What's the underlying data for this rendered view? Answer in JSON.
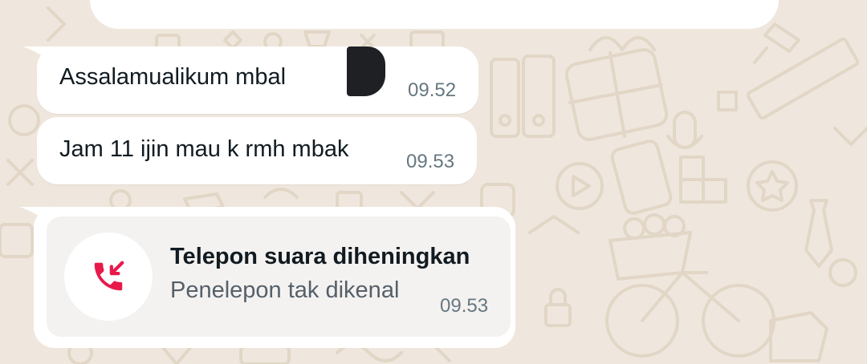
{
  "messages": [
    {
      "text": "Assalamualikum mbal",
      "time": "09.52"
    },
    {
      "text": "Jam 11 ijin mau k rmh mbak",
      "time": "09.53"
    }
  ],
  "call": {
    "title": "Telepon suara diheningkan",
    "subtitle": "Penelepon tak dikenal",
    "time": "09.53",
    "icon": "missed-call-icon"
  },
  "colors": {
    "wallpaper": "#efe7dd",
    "bubble": "#ffffff",
    "call_icon": "#e8194b",
    "timestamp": "#667781"
  }
}
